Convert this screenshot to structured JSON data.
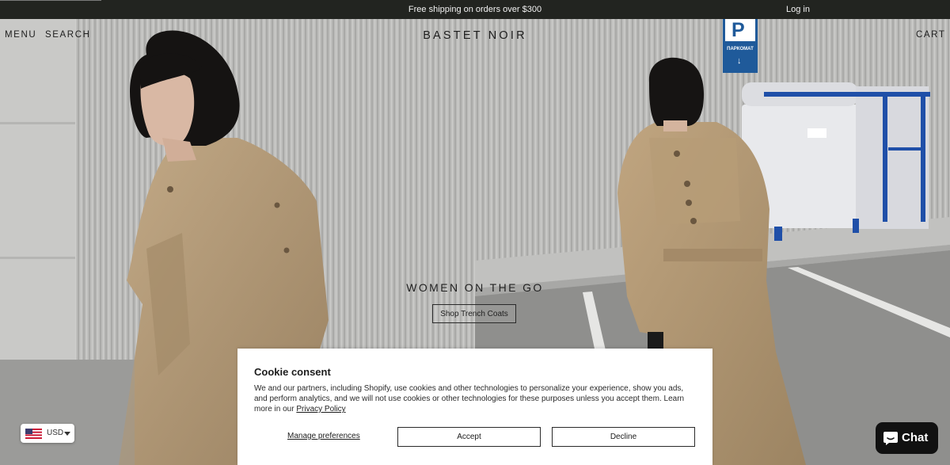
{
  "announcement": {
    "message": "Free shipping on orders over $300",
    "login": "Log in"
  },
  "header": {
    "menu": "MENU",
    "search": "SEARCH",
    "logo": "BASTET NOIR",
    "cart": "CART"
  },
  "hero": {
    "title": "WOMEN ON THE GO",
    "button": "Shop Trench Coats",
    "sign_letter": "P",
    "sign_text": "ПАРКОМАТ"
  },
  "cookie": {
    "title": "Cookie consent",
    "body": "We and our partners, including Shopify, use cookies and other technologies to personalize your experience, show you ads, and perform analytics, and we will not use cookies or other technologies for these purposes unless you accept them. Learn more in our",
    "privacy_link": "Privacy Policy",
    "manage": "Manage preferences",
    "accept": "Accept",
    "decline": "Decline"
  },
  "currency": {
    "code": "USD",
    "flag_icon": "us-flag-icon"
  },
  "chat": {
    "label": "Chat",
    "icon": "chat-bubble-icon"
  },
  "colors": {
    "announcement_bg": "#222420",
    "sign_blue": "#1f5a9a",
    "coat": "#b29a78",
    "chat_bg": "#111111"
  }
}
